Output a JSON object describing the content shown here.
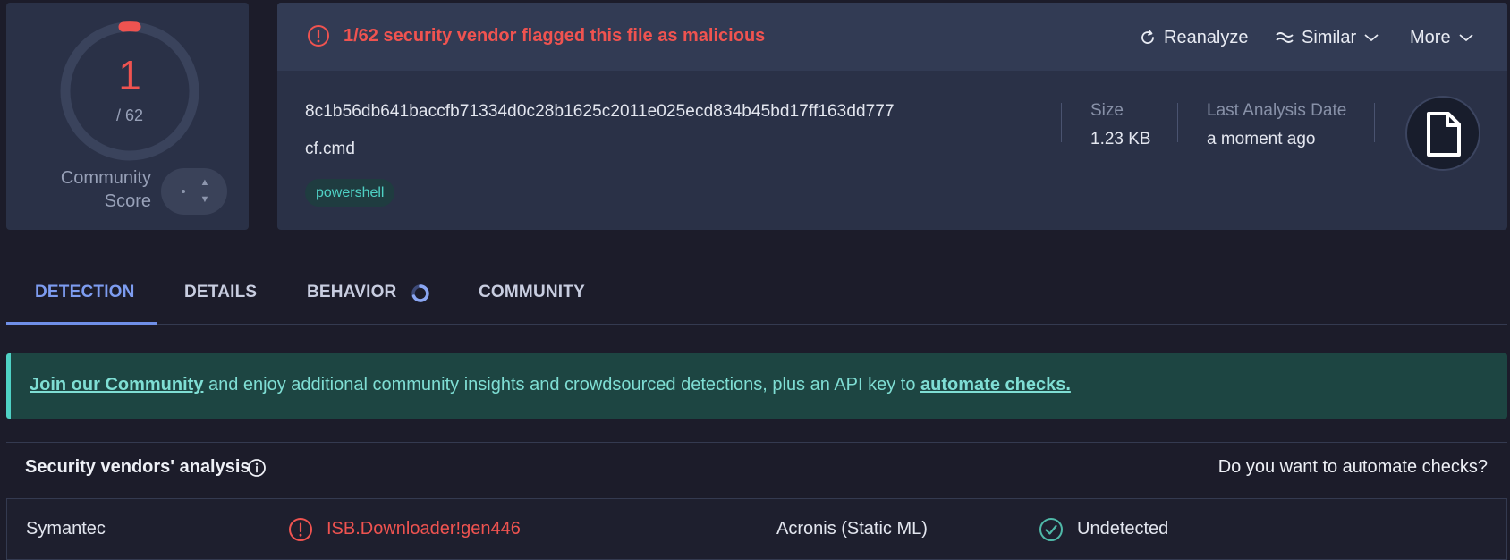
{
  "score": {
    "detections": "1",
    "total": "/ 62",
    "community_label_line1": "Community",
    "community_label_line2": "Score",
    "malicious_color": "#ef5350"
  },
  "header": {
    "alert_text": "1/62 security vendor flagged this file as malicious",
    "reanalyze_label": "Reanalyze",
    "similar_label": "Similar",
    "more_label": "More"
  },
  "file": {
    "hash": "8c1b56db641baccfb71334d0c28b1625c2011e025ecd834b45bd17ff163dd777",
    "name": "cf.cmd",
    "tag": "powershell",
    "size_label": "Size",
    "size_value": "1.23 KB",
    "date_label": "Last Analysis Date",
    "date_value": "a moment ago",
    "icon": "file-icon"
  },
  "tabs": [
    {
      "label": "DETECTION",
      "active": true
    },
    {
      "label": "DETAILS",
      "active": false
    },
    {
      "label": "BEHAVIOR",
      "active": false
    },
    {
      "label": "COMMUNITY",
      "active": false
    }
  ],
  "banner": {
    "link1": "Join our Community",
    "middle": " and enjoy additional community insights and crowdsourced detections, plus an API key to ",
    "link2": "automate checks."
  },
  "vendors": {
    "title": "Security vendors' analysis",
    "automate_question": "Do you want to automate checks?",
    "rows": [
      {
        "left_vendor": "Symantec",
        "left_result": "ISB.Downloader!gen446",
        "left_status": "malicious",
        "right_vendor": "Acronis (Static ML)",
        "right_result": "Undetected",
        "right_status": "undetected"
      }
    ]
  }
}
